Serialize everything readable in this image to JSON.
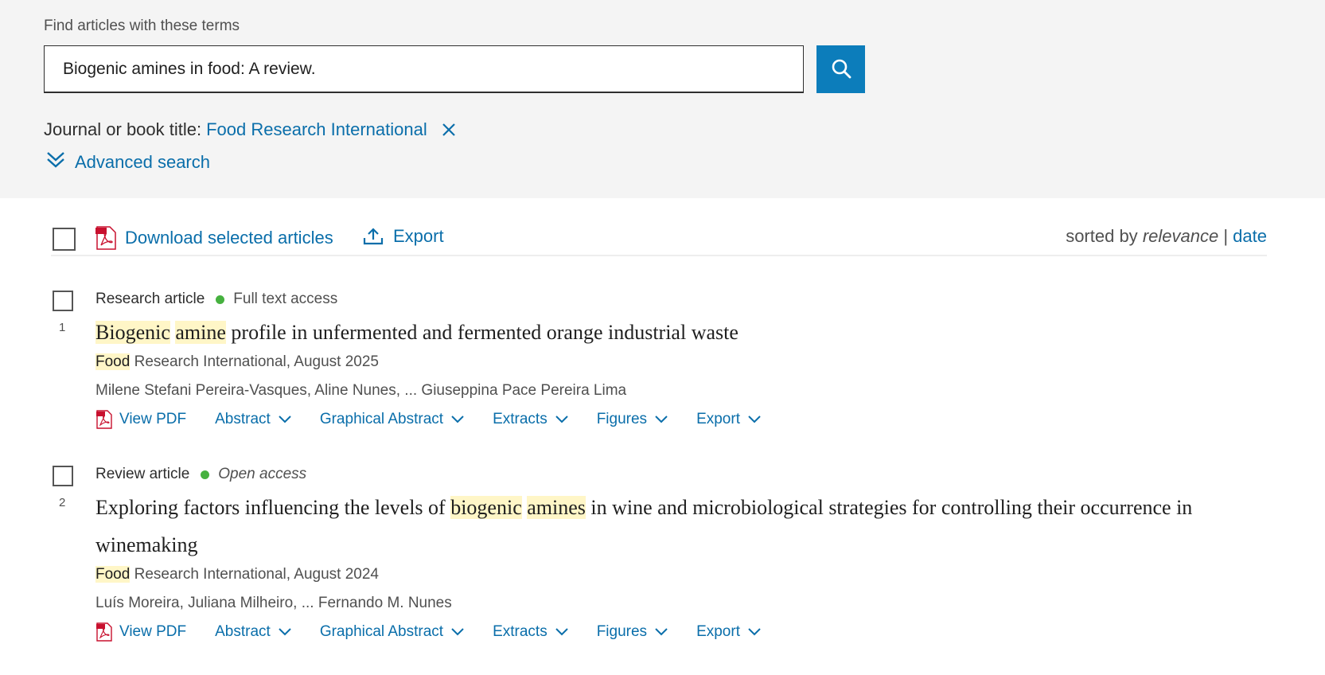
{
  "search": {
    "label": "Find articles with these terms",
    "value": "Biogenic amines in food: A review.",
    "button_icon": "search-icon"
  },
  "filter": {
    "label": "Journal or book title:",
    "value": "Food Research International"
  },
  "advanced_search": "Advanced search",
  "toolbar": {
    "download_label": "Download selected articles",
    "export_label": "Export",
    "sorted_by": "sorted by",
    "sort_relevance": "relevance",
    "sort_separator": "|",
    "sort_date": "date"
  },
  "results": [
    {
      "number": "1",
      "type": "Research article",
      "access": "Full text access",
      "title_parts": [
        "Biogenic",
        " ",
        "amine",
        " profile in unfermented and fermented orange industrial waste"
      ],
      "source_hl": "Food",
      "source_rest": " Research International, August 2025",
      "authors": "Milene Stefani Pereira-Vasques, Aline Nunes, ... Giuseppina Pace Pereira Lima",
      "actions": [
        "View PDF",
        "Abstract",
        "Graphical Abstract",
        "Extracts",
        "Figures",
        "Export"
      ]
    },
    {
      "number": "2",
      "type": "Review article",
      "access": "Open access",
      "title_parts": [
        "Exploring factors influencing the levels of ",
        "biogenic",
        " ",
        "amines",
        " in wine and microbiological strategies for controlling their occurrence in winemaking"
      ],
      "source_hl": "Food",
      "source_rest": " Research International, August 2024",
      "authors": "Luís Moreira, Juliana Milheiro, ... Fernando M. Nunes",
      "actions": [
        "View PDF",
        "Abstract",
        "Graphical Abstract",
        "Extracts",
        "Figures",
        "Export"
      ]
    }
  ],
  "colors": {
    "accent": "#0c7dbb",
    "link": "#0a6eaa",
    "highlight": "#fff6c7",
    "access_dot": "#46b13f",
    "panel_bg": "#f4f4f4"
  }
}
